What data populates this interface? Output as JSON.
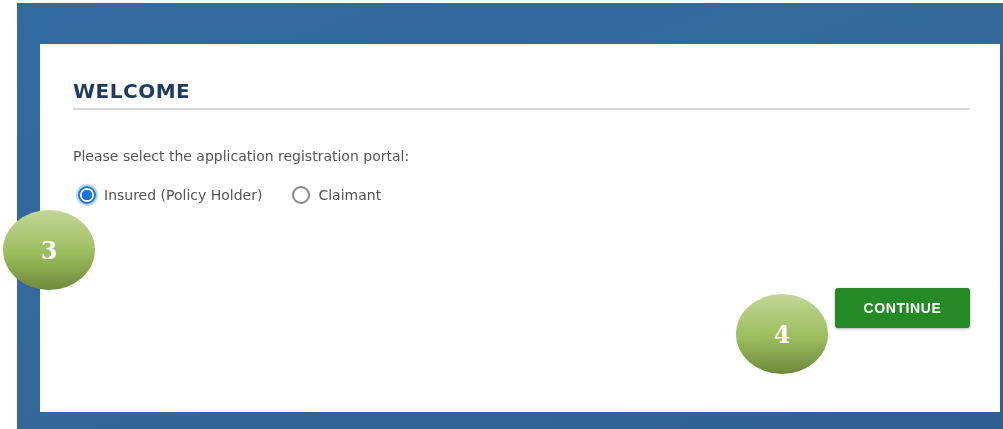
{
  "heading": "WELCOME",
  "prompt": "Please select the application registration portal:",
  "options": [
    {
      "label": "Insured (Policy Holder)",
      "selected": true
    },
    {
      "label": "Claimant",
      "selected": false
    }
  ],
  "button": "CONTINUE",
  "callouts": [
    {
      "label": "3"
    },
    {
      "label": "4"
    }
  ]
}
